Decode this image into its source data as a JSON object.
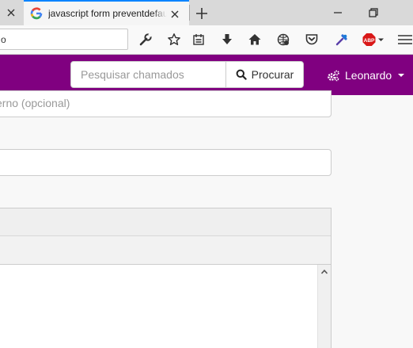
{
  "browser": {
    "active_tab_title": "javascript form preventdefault",
    "url_fragment": "o"
  },
  "header": {
    "search_placeholder": "Pesquisar chamados",
    "search_button_label": "Procurar",
    "user_name": "Leonardo",
    "brand_color": "#800080"
  },
  "form": {
    "field1_placeholder": "erno (opcional)"
  }
}
